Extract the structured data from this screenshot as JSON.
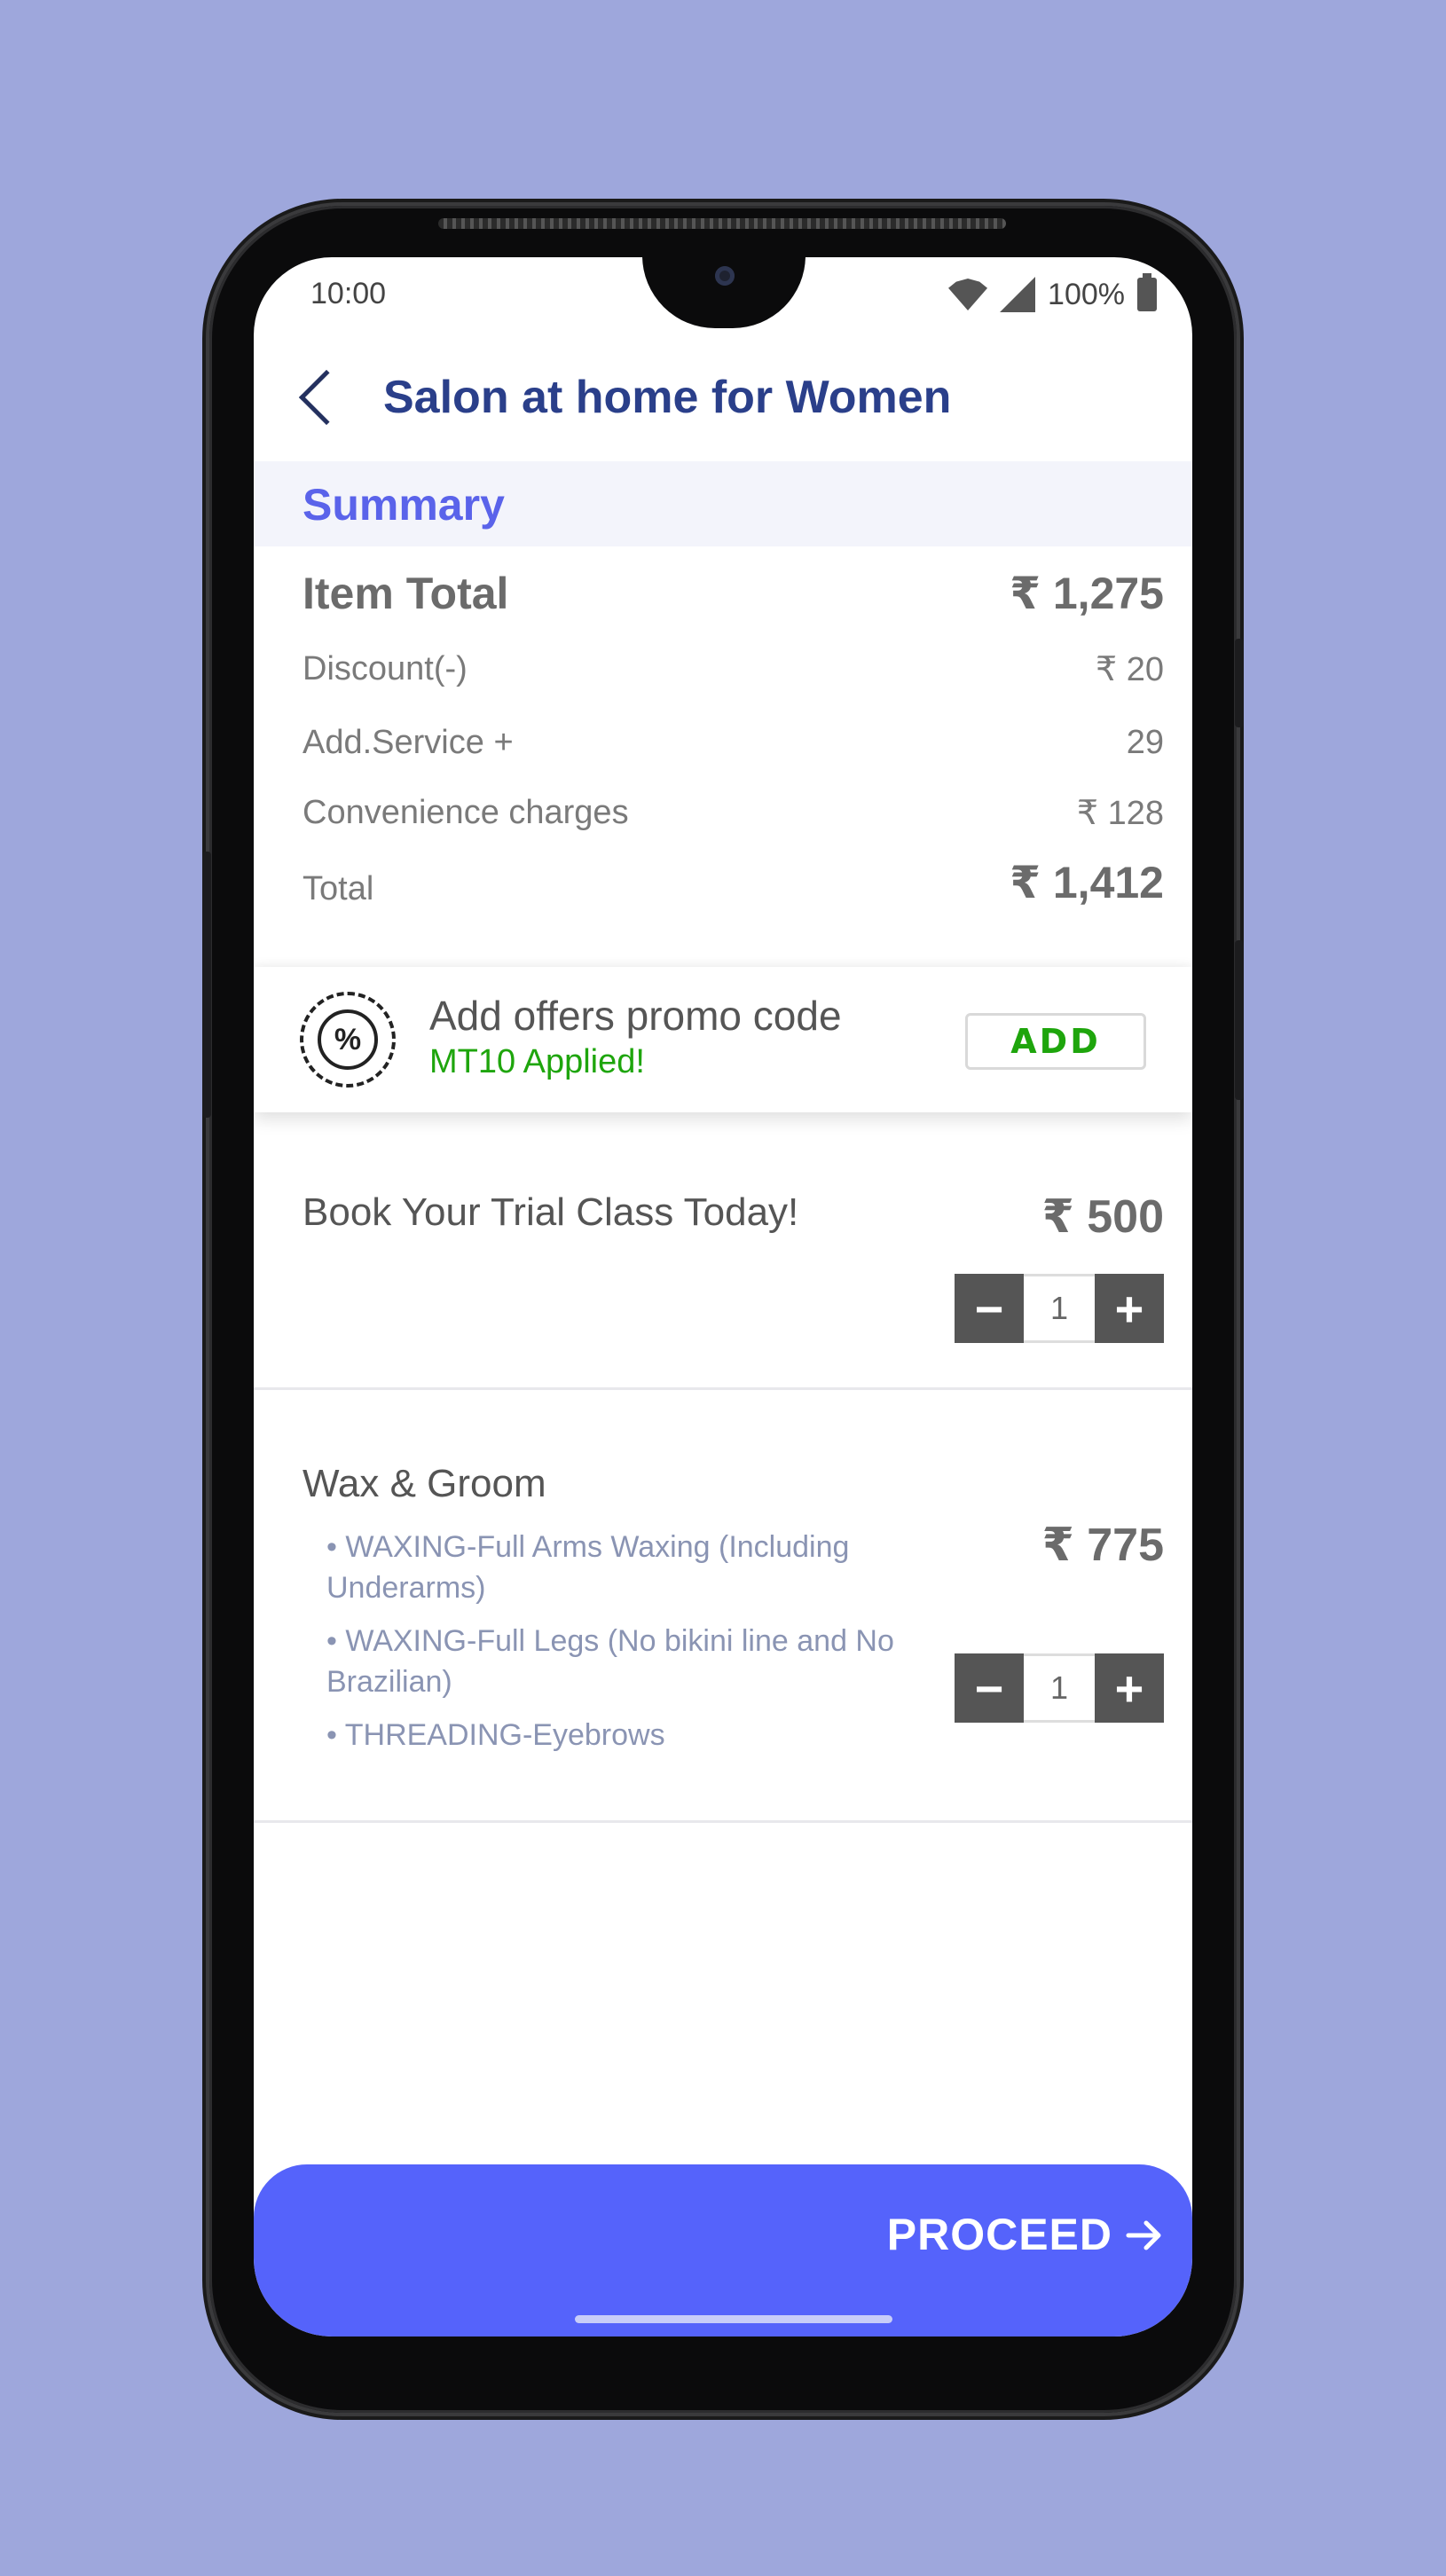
{
  "status_bar": {
    "time": "10:00",
    "network": "LTE",
    "battery": "100%"
  },
  "header": {
    "title": "Salon at home for Women"
  },
  "summary": {
    "heading": "Summary",
    "item_total_label": "Item Total",
    "item_total_value": "₹ 1,275",
    "discount_label": "Discount(-)",
    "discount_value": "₹ 20",
    "add_service_label": "Add.Service +",
    "add_service_value": "29",
    "convenience_label": "Convenience charges",
    "convenience_value": "₹ 128",
    "total_label": "Total",
    "total_value": "₹ 1,412"
  },
  "promo": {
    "title": "Add offers promo code",
    "applied": "MT10 Applied!",
    "button_label": "ADD"
  },
  "items": [
    {
      "name": "Book Your Trial Class Today!",
      "price": "₹ 500",
      "quantity": "1",
      "details": []
    },
    {
      "name": "Wax & Groom",
      "price": "₹ 775",
      "quantity": "1",
      "details": [
        "WAXING-Full Arms Waxing (Including Underarms)",
        "WAXING-Full Legs (No bikini line and No Brazilian)",
        "THREADING-Eyebrows"
      ]
    }
  ],
  "footer": {
    "proceed_label": "PROCEED"
  },
  "colors": {
    "accent": "#5563fb",
    "success": "#1ea50c",
    "title": "#2a3f8a",
    "background": "#9ea7dc"
  },
  "icons": [
    "back-icon",
    "promo-badge-icon",
    "minus-icon",
    "plus-icon",
    "arrow-right-icon",
    "wifi-icon",
    "signal-icon",
    "battery-icon"
  ]
}
